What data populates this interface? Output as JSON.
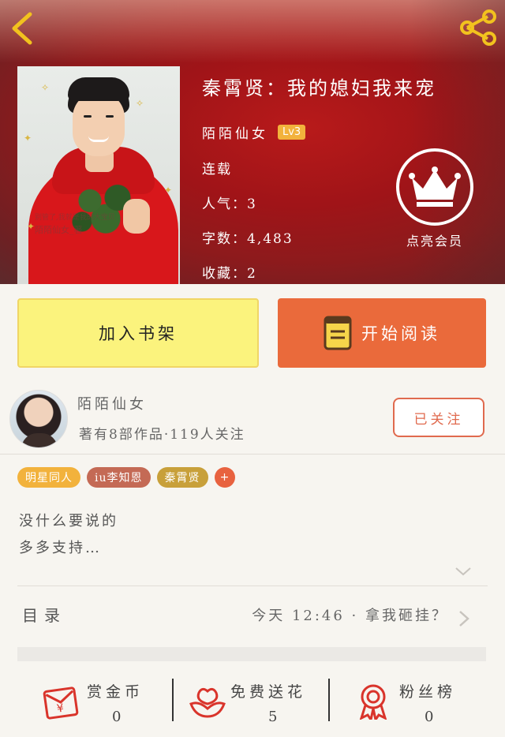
{
  "header": {
    "back_icon": "chevron-left-icon",
    "share_icon": "share-icon"
  },
  "book": {
    "title": "秦霄贤：我的媳妇我来宠",
    "author": "陌陌仙女",
    "level": "Lv3",
    "status": "连载",
    "popularity": "人气：3",
    "word_count": "字数：4,483",
    "favorites": "收藏：2",
    "cover_watermark": "陌陌仙女_著",
    "cover_watermark_line1": "别管了,我就是我的大宝贝"
  },
  "vip": {
    "icon": "crown-icon",
    "label": "点亮会员"
  },
  "actions": {
    "add_shelf": "加入书架",
    "start_reading": "开始阅读",
    "read_icon": "book-icon"
  },
  "author_card": {
    "name": "陌陌仙女",
    "stats": "著有8部作品·119人关注",
    "follow_label": "已关注"
  },
  "tags": [
    {
      "label": "明星同人",
      "color": "#f2b23c"
    },
    {
      "label": "iu李知恩",
      "color": "#c46a55"
    },
    {
      "label": "秦霄贤",
      "color": "#c8a03a"
    }
  ],
  "tag_add": "+",
  "description": {
    "line1": "没什么要说的",
    "line2": "多多支持…"
  },
  "toc": {
    "label": "目录",
    "latest": "今天 12:46 · 拿我砸挂？"
  },
  "bottom_stats": {
    "reward": {
      "label": "赏金币",
      "value": "0",
      "icon": "red-envelope-icon"
    },
    "flowers": {
      "label": "免费送花",
      "value": "5",
      "icon": "flower-icon"
    },
    "fans": {
      "label": "粉丝榜",
      "value": "0",
      "icon": "medal-icon"
    }
  },
  "colors": {
    "accent_orange": "#ea6a3b",
    "accent_yellow": "#fbf37d",
    "header_red": "#a01418",
    "icon_red": "#d9342b"
  }
}
